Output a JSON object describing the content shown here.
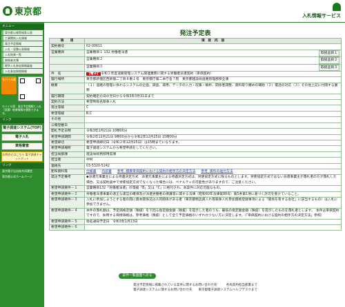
{
  "header": {
    "logo_text": "東京都",
    "service_title": "入札情報サービス"
  },
  "sidebar": {
    "heading_top": "メニュー",
    "items": [
      "東京都公報等検索公表",
      "工事関係入札情報",
      "発注予定情報",
      "入札・見積公表情報",
      "入札結果一覧",
      "資格者名簿",
      "競争入札参加資格審査",
      "入札参加資格情報"
    ],
    "mobile_label": "モバイル版",
    "mobile_note": "モバイル版：発注予定情報と入札（見積）結果情報を閲覧できます。",
    "heading_links": "リンク",
    "links": [
      "電子調達システム(TOP)",
      "電子入札",
      "資格審査"
    ],
    "chat_label": "お問合せはこちら 電子調達チャットボット",
    "heading_sites": "リンク",
    "site_links": [
      "東京電子自治体共同運営",
      "東京都公式ホームページ"
    ]
  },
  "page": {
    "title": "発注予定表"
  },
  "table": {
    "col_item": "項　　目",
    "col_content": "項　目　内　容",
    "rows": [
      {
        "label": "契約番号",
        "value": "02-00611"
      },
      {
        "label": "営業種目",
        "value": "営業種目１ 132 労働者派遣",
        "extra": "取扱品目１"
      },
      {
        "label": "",
        "value": "営業種目２",
        "extra": "取扱品目２"
      },
      {
        "label": "",
        "value": "営業種目３",
        "extra": "取扱品目３"
      },
      {
        "label": "件　名",
        "tag": "【電子】",
        "value": "令和２年度道路管理システム関連業務に関する労働者派遣契約（単価契約）"
      },
      {
        "label": "履行場所",
        "value": "東京都新宿区西新宿二丁目８番１号　東京都庁第二本庁舎７階　東京都建設局道路管理部保全課"
      },
      {
        "label": "概要",
        "value": "（１）道路の管理に係わるシステムの企画、調査、運用、データの入力・収集・解析、関係者調整、資料取り纏めの補助（２）電話の対応（３）その他上記に付随する業務"
      },
      {
        "label": "履行期間",
        "value": "契約確定の日の翌日から令和3年3月31日まで"
      },
      {
        "label": "契約方法",
        "value": "希望制指名競争入札"
      },
      {
        "label": "発注等級",
        "value": "C"
      },
      {
        "label": "希望等級",
        "value": "B,C"
      },
      {
        "label": "その他",
        "value": ""
      },
      {
        "label": "公報登載日",
        "value": ""
      },
      {
        "label": "開札予定日時",
        "value": "令和3年1月21日 10時00分"
      },
      {
        "label": "希望申請期間",
        "value": "令和2年12月21日 9時00分から令和2年12月25日 15時00分"
      },
      {
        "label": "希望締切",
        "value": "希望申請締切日（令和２年12月25日）は15時までになります。"
      },
      {
        "label": "希望申請場所",
        "value": "電子調達システムから希望申請をしてください。"
      },
      {
        "label": "担当局部課",
        "value": "建設局総務部用度課"
      },
      {
        "label": "担当者",
        "value": "中村"
      },
      {
        "label": "連絡先",
        "value": "03-5320-5242"
      },
      {
        "label": "配布資料等",
        "docs": [
          "仕様書",
          "内訳書",
          "参考 :積算単価契約における契約の相手方の決定方法",
          "参考 :資料の送付方法"
        ]
      },
      {
        "label": "発注予定備考",
        "value": "◆派遣元事業主による待遇決定方式　派遣元事業主による待遇決定方式は、労使協定方式に限るものとします。労使協定方式ではない派遣事業主が落札者の方が落札した場合、又は契約途中で労使協定方式でなくなった場合には、ペナルティの可能性がありますので、ご注意ください。"
      },
      {
        "label": "希望申請要件－１",
        "value": "営業種目132「労働者派遣」の等級「B」又は「C」に格付され、本案件に対応可能なもの。"
      },
      {
        "label": "希望申請要件－２",
        "value": "労働者派遣事業の適正な運営の確保及び派遣労働者の保護等に関する法律（昭和60年法律第88号）第5条第1項に基づく許可を受けていること。"
      },
      {
        "label": "希望申請要件－３",
        "value": "入札に参加しようとする者の間に資本関係又は人的関係がある者（東京都物品買入れ等競争入札参加資格登録事項による「関係を有する会社」に該当するもの）は入札に参加できません。"
      },
      {
        "label": "希望申請要件－４",
        "value": "本件の落札額は、予定価格定額（税抜）を下回る指定額金額（税抜）を提示した者のうち、最低の指定額金額（税抜）を提示したものを落札者とします。　本件は単価契約ですので、採用する目標価格は、参考価格（税抜）として全て予定価格のいずれか少ない方に決定します。（「単価契約における契約の相手方の決定方法」参照）"
      },
      {
        "label": "希望申請要件－５",
        "value": "指名通知予定日　令和3年1月13日"
      },
      {
        "label": "希望申請要件－６",
        "value": ""
      }
    ]
  },
  "back_button": "案件一覧画面へ戻る",
  "footer": {
    "line1": "発注予定情報に掲載されている案件に関するお問い合わせ先　　　各局契約担当部署まで",
    "line2": "電子調達システムに関するお問い合わせ先　　東京都電子調達システムヘルプデスクまで"
  }
}
